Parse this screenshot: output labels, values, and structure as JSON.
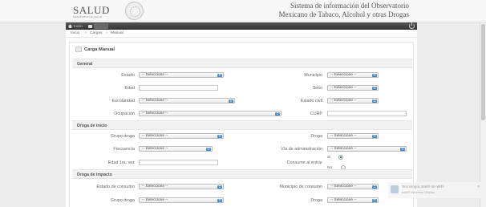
{
  "header": {
    "logo_text": "SALUD",
    "logo_subtitle": "SECRETARÍA DE SALUD",
    "title_line1": "Sistema de información del Observatorio",
    "title_line2": "Mexicano de Tabaco, Alcohol y otras Drogas"
  },
  "navbar": {
    "home_label": "Inicio",
    "data_label": "Datos"
  },
  "breadcrumb": {
    "home": "Inicio",
    "sep": "»",
    "cargas": "Cargas",
    "manual": "Manual"
  },
  "panel": {
    "title": "Carga Manual"
  },
  "sections": {
    "general": "General",
    "droga_inicio": "Droga de inicio",
    "droga_impacto": "Droga de impacto"
  },
  "form": {
    "placeholder": "-- Seleccione --",
    "general": {
      "estado": "Estado",
      "municipio": "Municipio",
      "edad": "Edad",
      "sexo": "Sexo",
      "escolaridad": "Escolaridad",
      "estado_civil": "Estado civil",
      "ocupacion": "Ocupación",
      "curp": "CURP"
    },
    "inicio": {
      "grupo_droga": "Grupo droga",
      "droga": "Droga",
      "frecuencia": "Frecuencia",
      "via": "Vía de administración",
      "edad_vez": "Edad 1ra. vez",
      "consume": "Consume al entrar",
      "si": "Si",
      "no": "No",
      "consume_selected": "Si"
    },
    "impacto": {
      "estado_consumo": "Estado de consumo",
      "municipio_consumo": "Municipio de consumo",
      "grupo_droga": "Grupo droga",
      "droga": "Droga"
    }
  },
  "watermark": {
    "title": "Tecnología Intel® de WiFi",
    "subtitle": "Intel® Wireless Display"
  },
  "colors": {
    "accent": "#3c78b8",
    "navbar": "#333333"
  }
}
